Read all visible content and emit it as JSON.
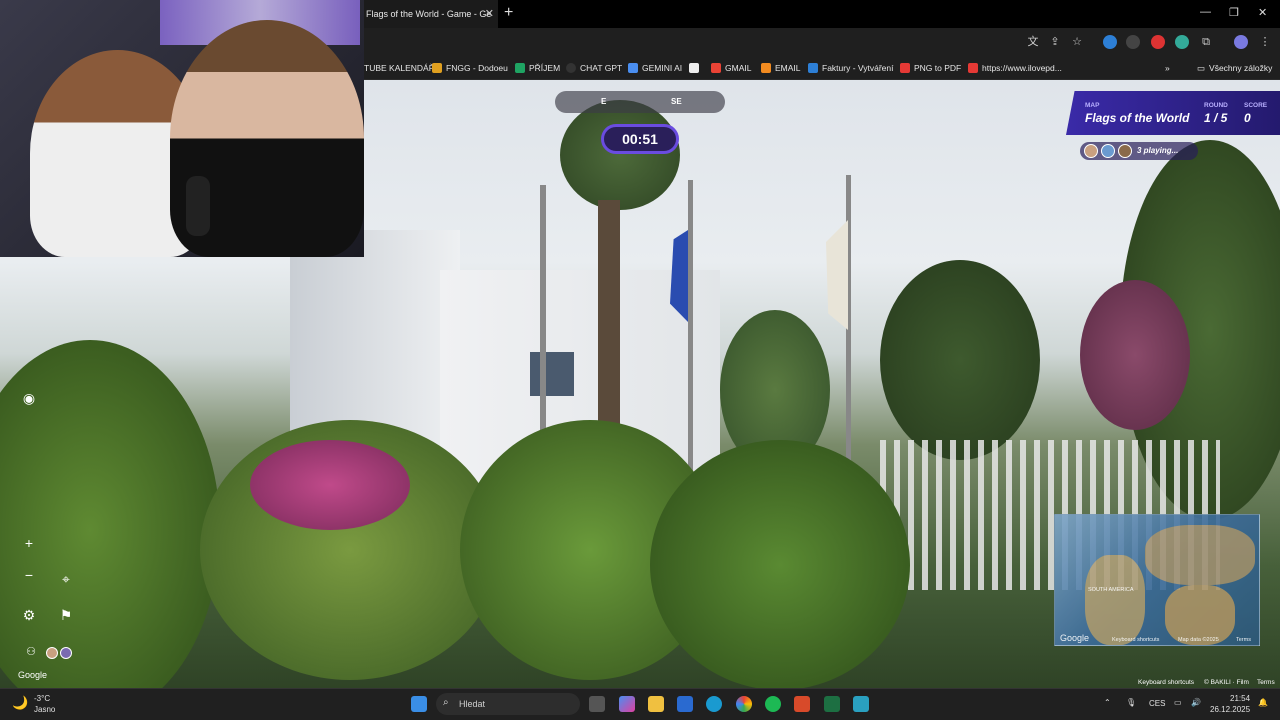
{
  "browser": {
    "tab_title": "Flags of the World - Game - Ge",
    "bookmarks": [
      {
        "label": "TUBE KALENDÁŘ",
        "color": "#d33"
      },
      {
        "label": "FNGG - Dodoeu",
        "color": "#e0a020"
      },
      {
        "label": "PŘÍJEM",
        "color": "#1fa463"
      },
      {
        "label": "CHAT GPT",
        "color": "#333"
      },
      {
        "label": "GEMINI AI",
        "color": "#4a8ef0"
      },
      {
        "label": "GMAIL",
        "color": "#ea4335"
      },
      {
        "label": "EMAIL",
        "color": "#f28b20"
      },
      {
        "label": "Faktury - Vytváření",
        "color": "#2d7fd6"
      },
      {
        "label": "PNG to PDF",
        "color": "#e53935"
      },
      {
        "label": "https://www.ilovepd...",
        "color": "#e53935"
      }
    ],
    "all_bookmarks_label": "Všechny záložky"
  },
  "game": {
    "compass": {
      "e": "E",
      "se": "SE"
    },
    "timer": "00:51",
    "map_label": "MAP",
    "map_name": "Flags of the World",
    "round_label": "ROUND",
    "round_value": "1 / 5",
    "score_label": "SCORE",
    "score_value": "0",
    "players_text": "3 playing...",
    "controls": {
      "zoom_in": "+",
      "zoom_out": "−"
    }
  },
  "minimap": {
    "region_label": "SOUTH AMERICA",
    "google": "Google",
    "keyboard": "Keyboard shortcuts",
    "map_data": "Map data ©2025",
    "terms": "Terms"
  },
  "streetview": {
    "google": "Google",
    "keyboard_shortcuts": "Keyboard shortcuts",
    "copyright": "© BAKILI · Film",
    "terms": "Terms"
  },
  "taskbar": {
    "weather_temp": "-3°C",
    "weather_desc": "Jasno",
    "search_placeholder": "Hledat",
    "lang": "CES",
    "time": "21:54",
    "date": "26.12.2025"
  },
  "colors": {
    "hud_purple": "#3a2aa8",
    "timer_border": "#6a4ce0"
  }
}
